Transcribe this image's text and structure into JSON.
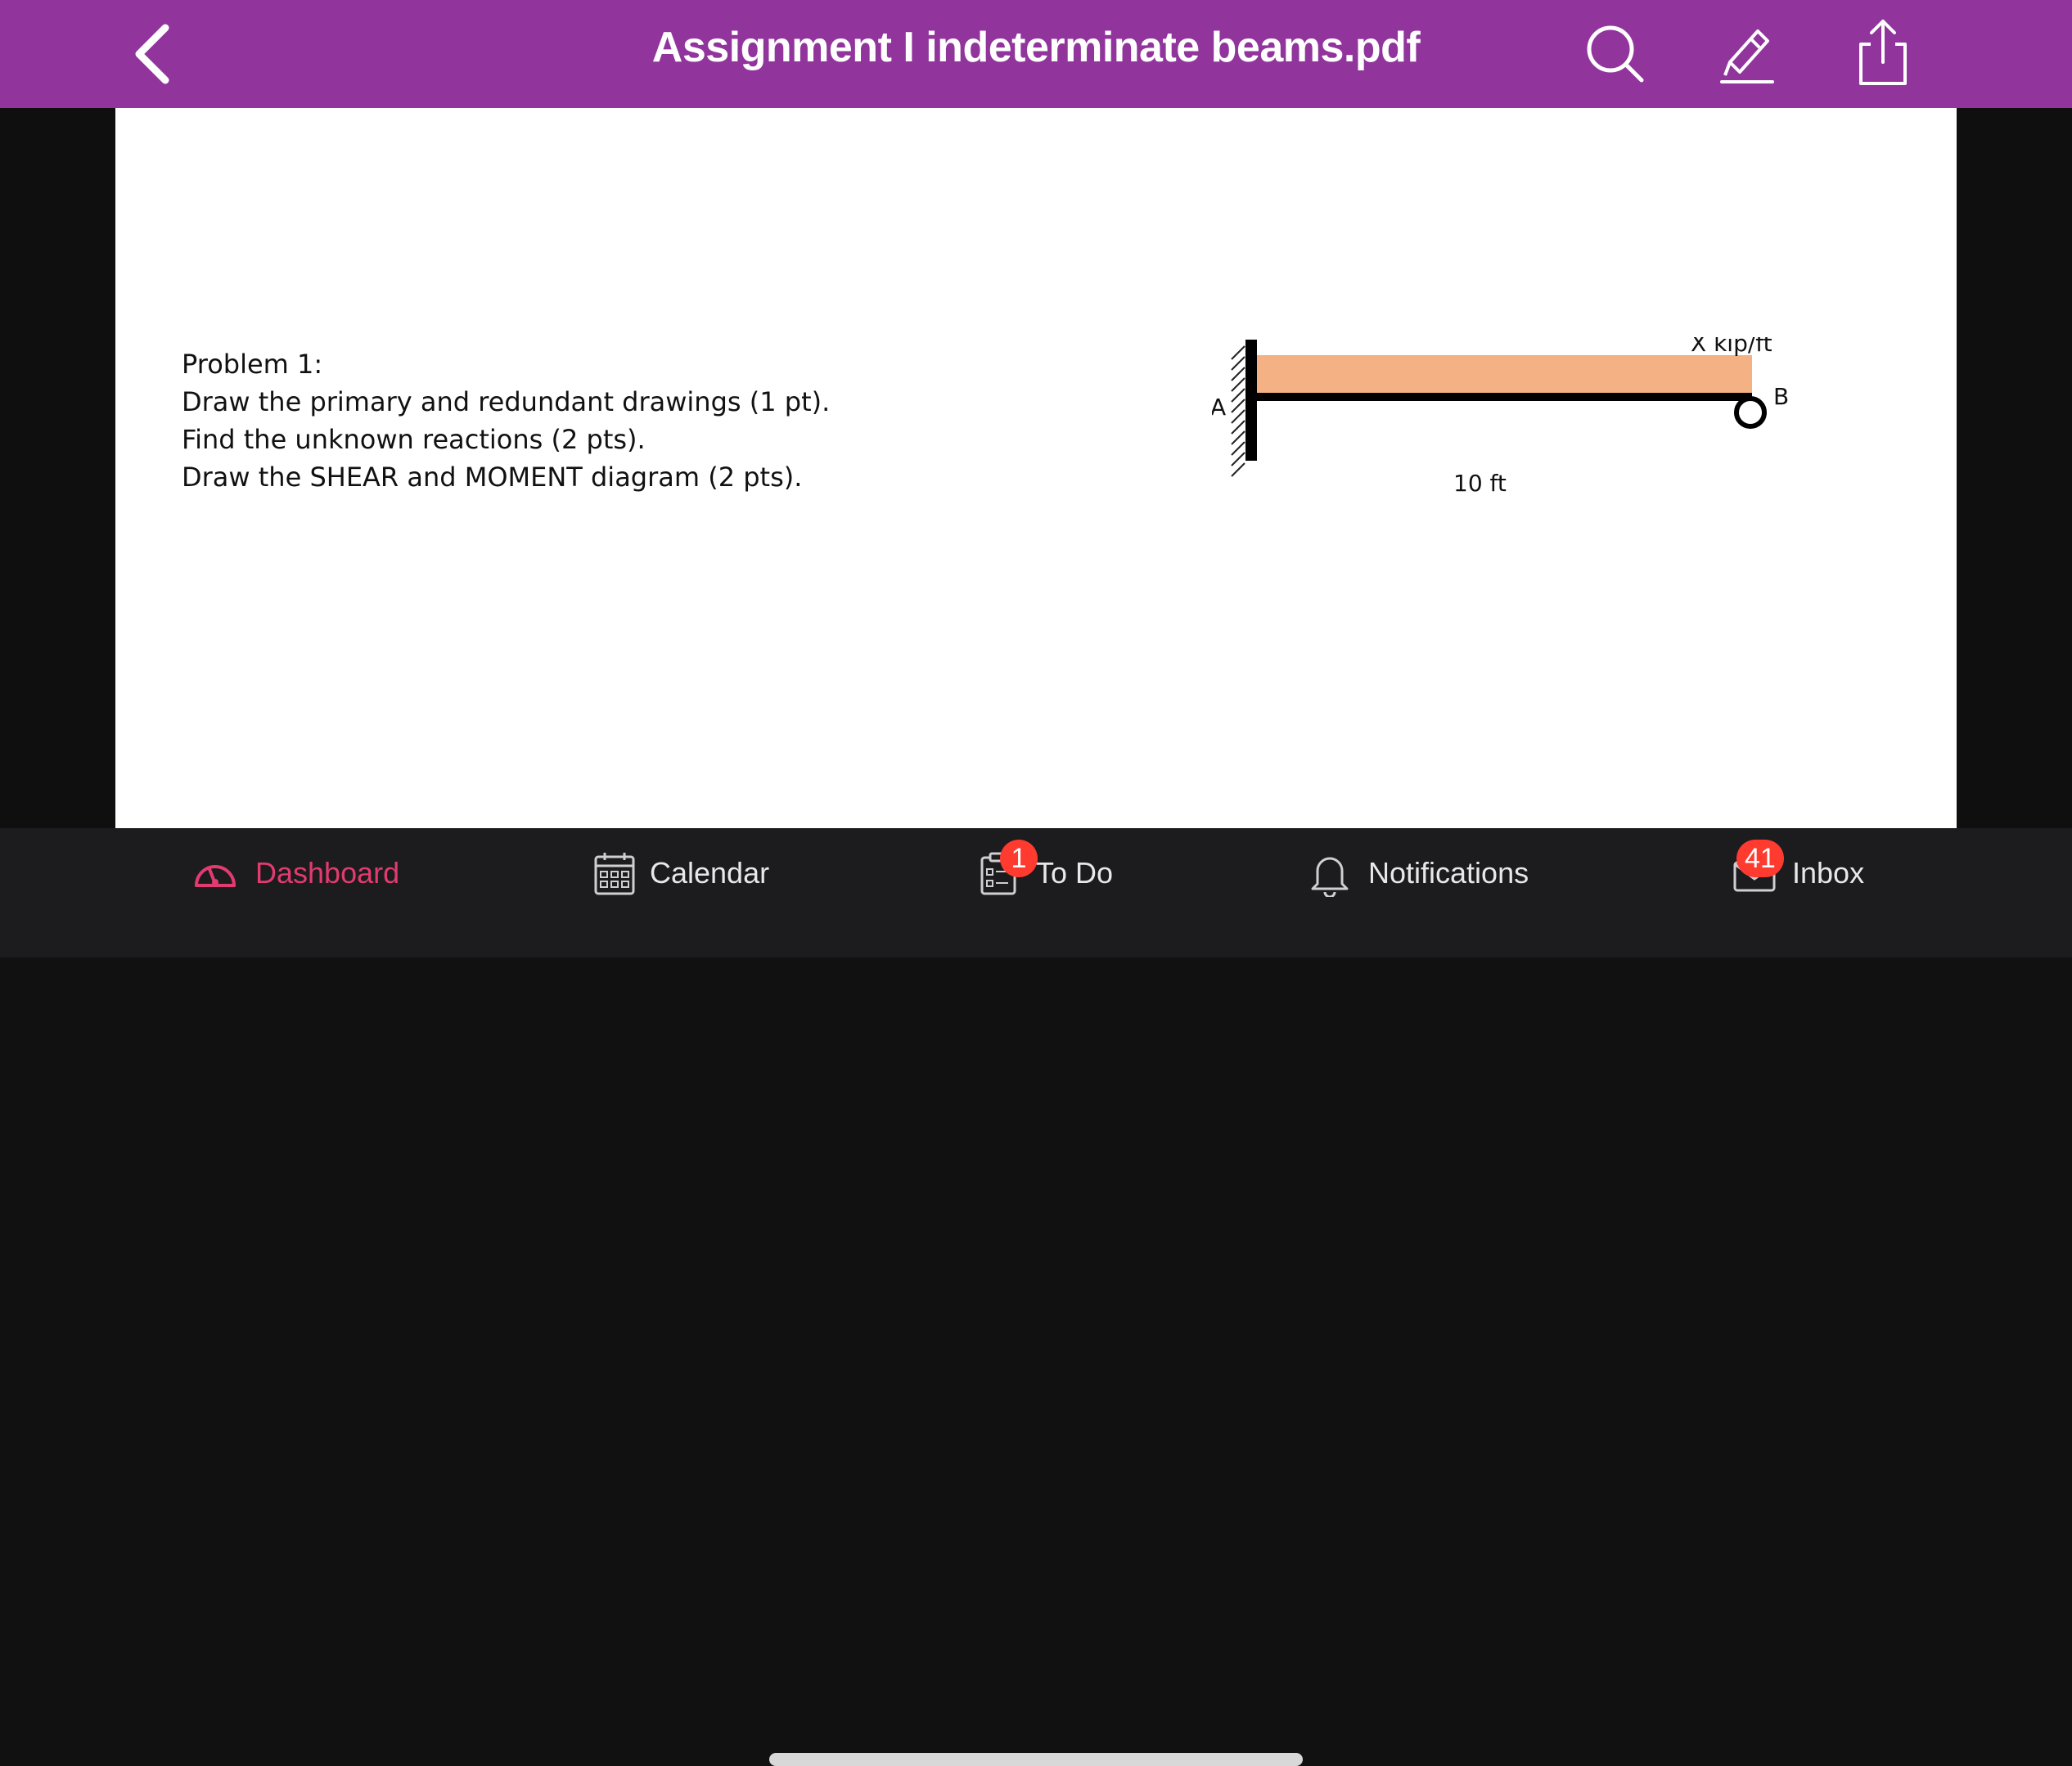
{
  "header": {
    "title": "Assignment I indeterminate beams.pdf",
    "icons": [
      "back-chevron-icon",
      "search-icon",
      "annotate-pen-icon",
      "share-icon"
    ]
  },
  "document": {
    "problem_lines": [
      "Problem 1:",
      "Draw the primary and redundant drawings (1 pt).",
      "Find the unknown reactions (2 pts).",
      "Draw the SHEAR and MOMENT diagram (2 pts)."
    ],
    "diagram": {
      "load_label": "X kip/ft",
      "support_a_label": "A",
      "support_b_label": "B",
      "span_label": "10 ft",
      "load_color": "#f4b183"
    }
  },
  "tabbar": {
    "tabs": [
      {
        "label": "Dashboard",
        "icon": "dashboard-gauge-icon",
        "active": true
      },
      {
        "label": "Calendar",
        "icon": "calendar-icon",
        "active": false
      },
      {
        "label": "To Do",
        "icon": "todo-clipboard-icon",
        "active": false,
        "badge": "1"
      },
      {
        "label": "Notifications",
        "icon": "bell-icon",
        "active": false
      },
      {
        "label": "Inbox",
        "icon": "inbox-envelope-icon",
        "active": false,
        "badge": "41"
      }
    ]
  },
  "colors": {
    "header_bg": "#91359d",
    "active_tab": "#e13b6f",
    "badge": "#ff3b30"
  }
}
